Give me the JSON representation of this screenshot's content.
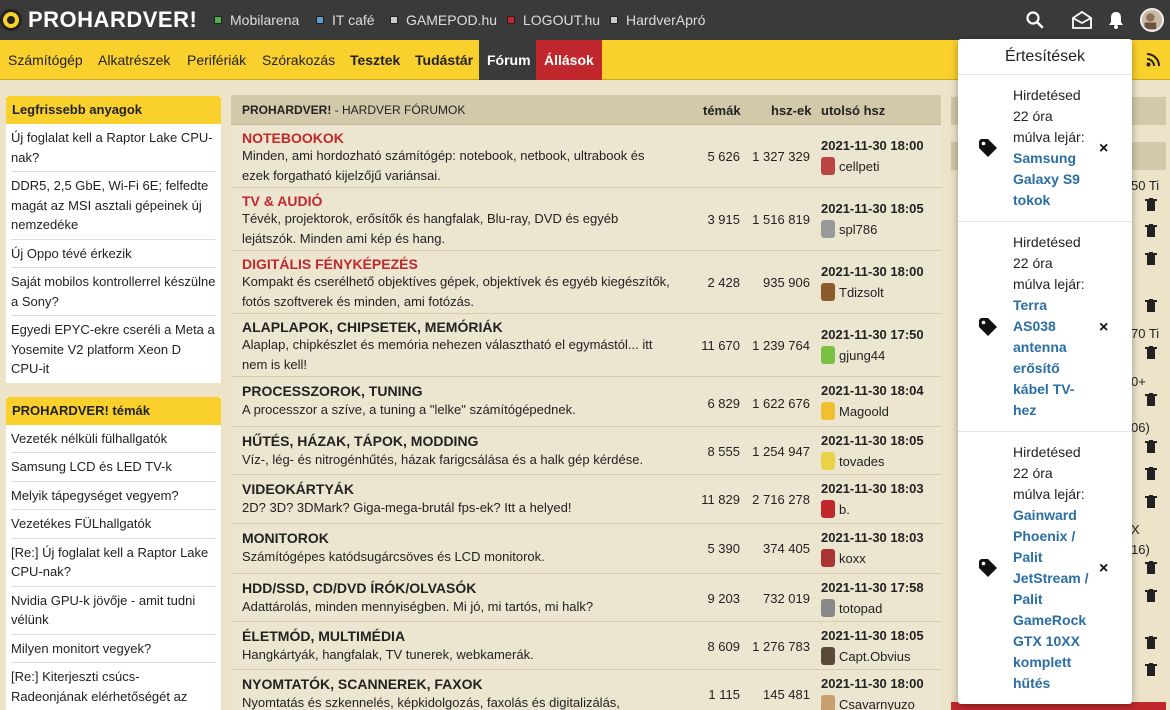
{
  "topbar": {
    "logo": "PROHARDVER!",
    "sites": [
      {
        "label": "Mobilarena",
        "color": "#4caf50"
      },
      {
        "label": "IT café",
        "color": "#5b9bd5"
      },
      {
        "label": "GAMEPOD.hu",
        "color": "#cccccc"
      },
      {
        "label": "LOGOUT.hu",
        "color": "#c0282d"
      },
      {
        "label": "HardverApró",
        "color": "#cccccc"
      }
    ],
    "icons": [
      "search-icon",
      "mail-icon",
      "bell-icon",
      "user-avatar"
    ]
  },
  "nav": {
    "items": [
      "Számítógép",
      "Alkatrészek",
      "Perifériák",
      "Szórakozás",
      "Tesztek",
      "Tudástár",
      "Fórum",
      "Állások"
    ]
  },
  "left": {
    "latest_title": "Legfrissebb anyagok",
    "latest": [
      "Új foglalat kell a Raptor Lake CPU-nak?",
      "DDR5, 2,5 GbE, Wi-Fi 6E; felfedte magát az MSI asztali gépeinek új nemzedéke",
      "Új Oppo tévé érkezik",
      "Saját mobilos kontrollerrel készülne a Sony?",
      "Egyedi EPYC-ekre cseréli a Meta a Yosemite V2 platform Xeon D CPU-it"
    ],
    "topics_title": "PROHARDVER! témák",
    "topics": [
      "Vezeték nélküli fülhallgatók",
      "Samsung LCD és LED TV-k",
      "Melyik tápegységet vegyem?",
      "Vezetékes FÜLhallgatók",
      "[Re:] Új foglalat kell a Raptor Lake CPU-nak?",
      "Nvidia GPU-k jövője - amit tudni vélünk",
      "Milyen monitort vegyek?",
      "[Re:] Kiterjeszti csúcs-Radeonjának elérhetőségét az AMD"
    ]
  },
  "forum": {
    "title_bold": "PROHARDVER!",
    "title_rest": " - HARDVER FÓRUMOK",
    "col_topics": "témák",
    "col_posts": "hsz-ek",
    "col_last": "utolsó hsz",
    "rows": [
      {
        "name": "NOTEBOOKOK",
        "desc": "Minden, ami hordozható számítógép: notebook, netbook, ultrabook és ezek forgatható kijelzőjű variánsai.",
        "topics": "5 626",
        "posts": "1 327 329",
        "date": "2021-11-30 18:00",
        "user": "cellpeti"
      },
      {
        "name": "TV & AUDIÓ",
        "desc": "Tévék, projektorok, erősítők és hangfalak, Blu-ray, DVD és egyéb lejátszók. Minden ami kép és hang.",
        "topics": "3 915",
        "posts": "1 516 819",
        "date": "2021-11-30 18:05",
        "user": "spl786"
      },
      {
        "name": "DIGITÁLIS FÉNYKÉPEZÉS",
        "desc": "Kompakt és cserélhető objektíves gépek, objektívek és egyéb kiegészítők, fotós szoftverek és minden, ami fotózás.",
        "topics": "2 428",
        "posts": "935 906",
        "date": "2021-11-30 18:00",
        "user": "Tdizsolt"
      },
      {
        "name": "ALAPLAPOK, CHIPSETEK, MEMÓRIÁK",
        "desc": "Alaplap, chipkészlet és memória nehezen választható el egymástól... itt nem is kell!",
        "topics": "11 670",
        "posts": "1 239 764",
        "date": "2021-11-30 17:50",
        "user": "gjung44"
      },
      {
        "name": "PROCESSZOROK, TUNING",
        "desc": "A processzor a szíve, a tuning a \"lelke\" számítógépednek.",
        "topics": "6 829",
        "posts": "1 622 676",
        "date": "2021-11-30 18:04",
        "user": "Magoold"
      },
      {
        "name": "HŰTÉS, HÁZAK, TÁPOK, MODDING",
        "desc": "Víz-, lég- és nitrogénhűtés, házak farigcsálása és a halk gép kérdése.",
        "topics": "8 555",
        "posts": "1 254 947",
        "date": "2021-11-30 18:05",
        "user": "tovades"
      },
      {
        "name": "VIDEOKÁRTYÁK",
        "desc": "2D? 3D? 3DMark? Giga-mega-brutál fps-ek? Itt a helyed!",
        "topics": "11 829",
        "posts": "2 716 278",
        "date": "2021-11-30 18:03",
        "user": "b."
      },
      {
        "name": "MONITOROK",
        "desc": "Számítógépes katódsugárcsöves és LCD monitorok.",
        "topics": "5 390",
        "posts": "374 405",
        "date": "2021-11-30 18:03",
        "user": "koxx"
      },
      {
        "name": "HDD/SSD, CD/DVD ÍRÓK/OLVASÓK",
        "desc": "Adattárolás, minden mennyiségben. Mi jó, mi tartós, mi halk?",
        "topics": "9 203",
        "posts": "732 019",
        "date": "2021-11-30 17:58",
        "user": "totopad"
      },
      {
        "name": "ÉLETMÓD, MULTIMÉDIA",
        "desc": "Hangkártyák, hangfalak, TV tunerek, webkamerák.",
        "topics": "8 609",
        "posts": "1 276 783",
        "date": "2021-11-30 18:05",
        "user": "Capt.Obvius"
      },
      {
        "name": "NYOMTATÓK, SCANNEREK, FAXOK",
        "desc": "Nyomtatás és szkennelés, képkidolgozás, faxolás és digitalizálás, imaging.",
        "topics": "1 115",
        "posts": "145 481",
        "date": "2021-11-30 18:00",
        "user": "Csavarnyuzo"
      }
    ]
  },
  "right_fragments": [
    "50 Ti",
    "70 Ti",
    "0+",
    "06)",
    "X",
    "16)"
  ],
  "notifications": {
    "title": "Értesítések",
    "items": [
      {
        "text": "Hirdetésed 22 óra múlva lejár:",
        "link": "Samsung Galaxy S9 tokok"
      },
      {
        "text": "Hirdetésed 22 óra múlva lejár:",
        "link": "Terra AS038 antenna erősítő kábel TV-hez"
      },
      {
        "text": "Hirdetésed 22 óra múlva lejár:",
        "link": "Gainward Phoenix / Palit JetStream / Palit GameRock GTX 10XX komplett hűtés"
      }
    ],
    "close_label": "×"
  }
}
